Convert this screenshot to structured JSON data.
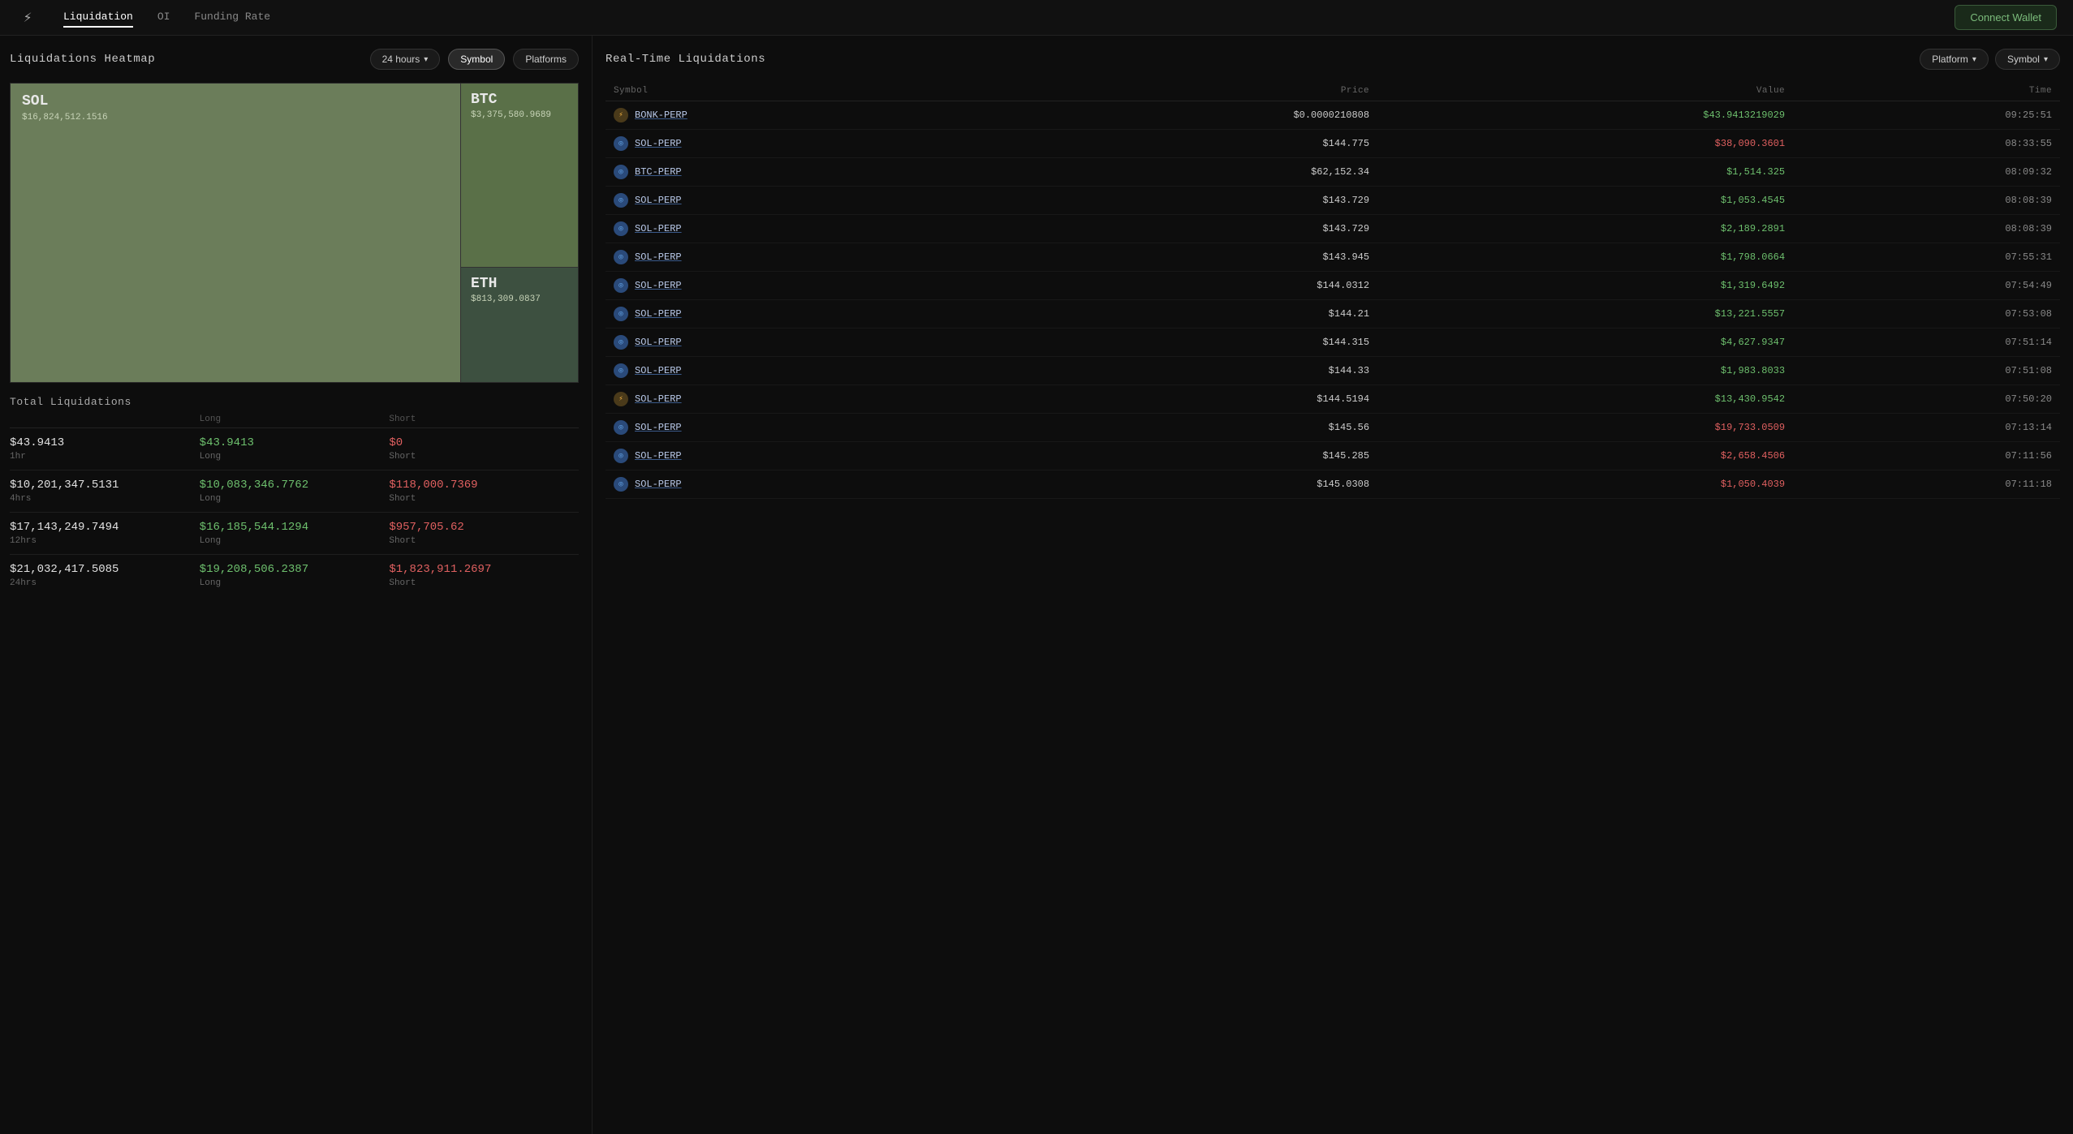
{
  "nav": {
    "logo": "⚡",
    "tabs": [
      {
        "label": "Liquidation",
        "active": true
      },
      {
        "label": "OI",
        "active": false
      },
      {
        "label": "Funding Rate",
        "active": false
      }
    ],
    "connect_wallet": "Connect Wallet"
  },
  "left": {
    "title": "Liquidations Heatmap",
    "filter_time": "24 hours",
    "filter_symbol": "Symbol",
    "filter_platforms": "Platforms",
    "heatmap": {
      "sol_label": "SOL",
      "sol_value": "$16,824,512.1516",
      "btc_label": "BTC",
      "btc_value": "$3,375,580.9689",
      "eth_label": "ETH",
      "eth_value": "$813,309.0837"
    },
    "total_title": "Total Liquidations",
    "rows": [
      {
        "period": "1hr",
        "total": "$43.9413",
        "long": "$43.9413",
        "short": "$0"
      },
      {
        "period": "4hrs",
        "total": "$10,201,347.5131",
        "long": "$10,083,346.7762",
        "short": "$118,000.7369"
      },
      {
        "period": "12hrs",
        "total": "$17,143,249.7494",
        "long": "$16,185,544.1294",
        "short": "$957,705.62"
      },
      {
        "period": "24hrs",
        "total": "$21,032,417.5085",
        "long": "$19,208,506.2387",
        "short": "$1,823,911.2697"
      }
    ]
  },
  "right": {
    "title": "Real-Time Liquidations",
    "filter_platform": "Platform",
    "filter_symbol": "Symbol",
    "columns": [
      "Symbol",
      "Price",
      "Value",
      "Time"
    ],
    "rows": [
      {
        "icon": "flash",
        "symbol": "BONK-PERP",
        "price": "$0.0000210808",
        "value": "$43.9413219029",
        "value_color": "green",
        "time": "09:25:51"
      },
      {
        "icon": "drift",
        "symbol": "SOL-PERP",
        "price": "$144.775",
        "value": "$38,090.3601",
        "value_color": "red",
        "time": "08:33:55"
      },
      {
        "icon": "drift",
        "symbol": "BTC-PERP",
        "price": "$62,152.34",
        "value": "$1,514.325",
        "value_color": "green",
        "time": "08:09:32"
      },
      {
        "icon": "drift",
        "symbol": "SOL-PERP",
        "price": "$143.729",
        "value": "$1,053.4545",
        "value_color": "green",
        "time": "08:08:39"
      },
      {
        "icon": "drift",
        "symbol": "SOL-PERP",
        "price": "$143.729",
        "value": "$2,189.2891",
        "value_color": "green",
        "time": "08:08:39"
      },
      {
        "icon": "drift",
        "symbol": "SOL-PERP",
        "price": "$143.945",
        "value": "$1,798.0664",
        "value_color": "green",
        "time": "07:55:31"
      },
      {
        "icon": "drift",
        "symbol": "SOL-PERP",
        "price": "$144.0312",
        "value": "$1,319.6492",
        "value_color": "green",
        "time": "07:54:49"
      },
      {
        "icon": "drift",
        "symbol": "SOL-PERP",
        "price": "$144.21",
        "value": "$13,221.5557",
        "value_color": "green",
        "time": "07:53:08"
      },
      {
        "icon": "drift",
        "symbol": "SOL-PERP",
        "price": "$144.315",
        "value": "$4,627.9347",
        "value_color": "green",
        "time": "07:51:14"
      },
      {
        "icon": "drift",
        "symbol": "SOL-PERP",
        "price": "$144.33",
        "value": "$1,983.8033",
        "value_color": "green",
        "time": "07:51:08"
      },
      {
        "icon": "flash",
        "symbol": "SOL-PERP",
        "price": "$144.5194",
        "value": "$13,430.9542",
        "value_color": "green",
        "time": "07:50:20"
      },
      {
        "icon": "drift",
        "symbol": "SOL-PERP",
        "price": "$145.56",
        "value": "$19,733.0509",
        "value_color": "red",
        "time": "07:13:14"
      },
      {
        "icon": "drift",
        "symbol": "SOL-PERP",
        "price": "$145.285",
        "value": "$2,658.4506",
        "value_color": "red",
        "time": "07:11:56"
      },
      {
        "icon": "drift",
        "symbol": "SOL-PERP",
        "price": "$145.0308",
        "value": "$1,050.4039",
        "value_color": "red",
        "time": "07:11:18"
      }
    ]
  }
}
